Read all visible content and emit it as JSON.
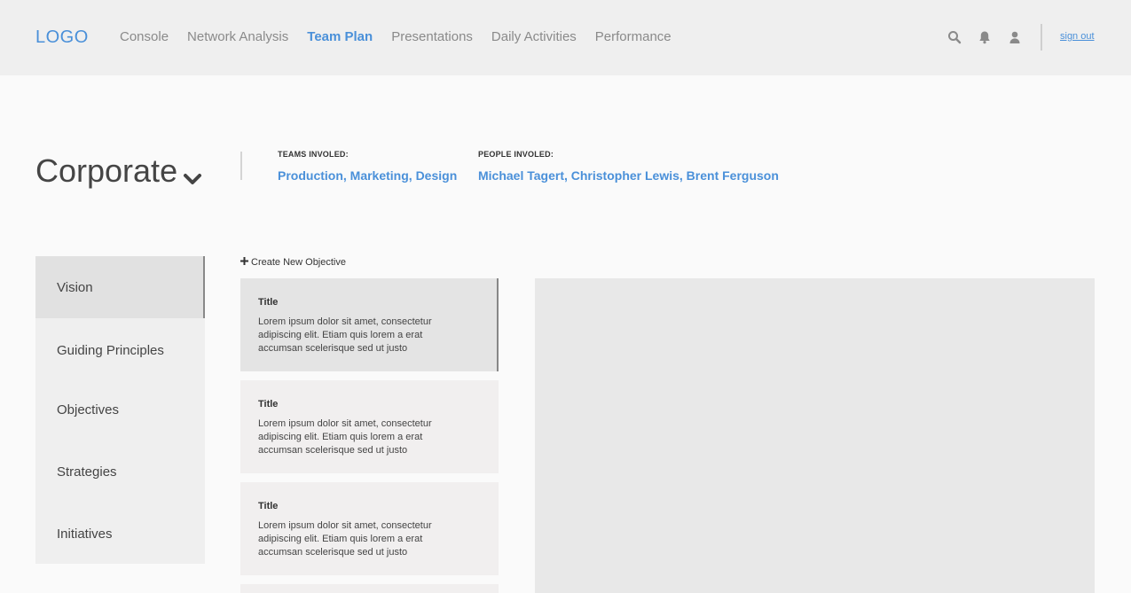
{
  "header": {
    "logo": "LOGO",
    "nav": [
      "Console",
      "Network Analysis",
      "Team Plan",
      "Presentations",
      "Daily Activities",
      "Performance"
    ],
    "active_nav": "Team Plan",
    "icons": [
      "search-icon",
      "bell-icon",
      "user-icon"
    ],
    "sign_out": "sign out"
  },
  "org": {
    "name": "Corporate",
    "teams_label": "TEAMS INVOLED:",
    "teams_value": "Production, Marketing, Design",
    "people_label": "PEOPLE INVOLED:",
    "people_value": "Michael Tagert, Christopher Lewis, Brent Ferguson"
  },
  "sidebar": {
    "items": [
      "Vision",
      "Guiding Principles",
      "Objectives",
      "Strategies",
      "Initiatives"
    ],
    "active": "Vision"
  },
  "objectives": {
    "create_label": "Create New Objective",
    "cards": [
      {
        "title": "Title",
        "body": "Lorem ipsum dolor sit amet, consectetur adipiscing elit. Etiam quis lorem a erat accumsan scelerisque sed ut justo"
      },
      {
        "title": "Title",
        "body": "Lorem ipsum dolor sit amet, consectetur adipiscing elit. Etiam quis lorem a erat accumsan scelerisque sed ut justo"
      },
      {
        "title": "Title",
        "body": "Lorem ipsum dolor sit amet, consectetur adipiscing elit. Etiam quis lorem a erat accumsan scelerisque sed ut justo"
      }
    ]
  },
  "colors": {
    "accent": "#4a90d9",
    "topbar": "#efefef",
    "panel": "#e8e8e8"
  }
}
